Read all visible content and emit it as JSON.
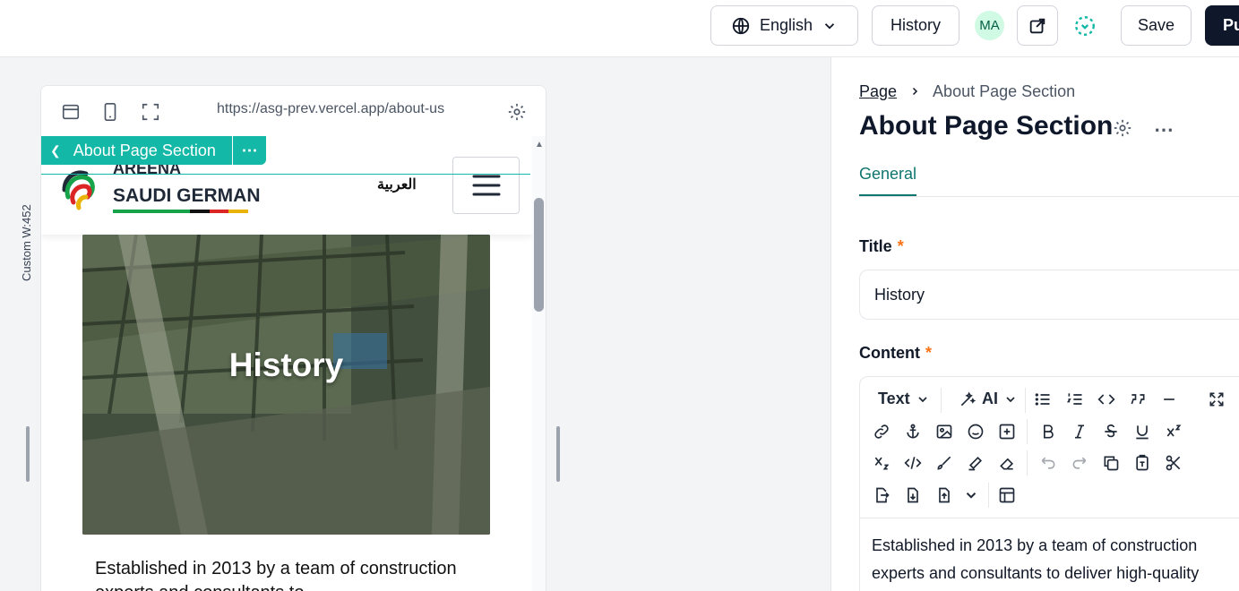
{
  "topbar": {
    "language": "English",
    "history_label": "History",
    "avatar_initials": "MA",
    "save_label": "Save",
    "publish_label": "Pu"
  },
  "canvas": {
    "size_label": "Custom W:452"
  },
  "preview": {
    "url": "https://asg-prev.vercel.app/about-us",
    "selected_component": "About Page Section",
    "site": {
      "logo_top": "AREENA",
      "logo_bottom": "SAUDI GERMAN",
      "language_link": "العربية",
      "hero_title": "History",
      "body_text": "Established in 2013 by a team of construction experts and consultants to"
    }
  },
  "panel": {
    "breadcrumb": [
      "Page",
      "About Page Section"
    ],
    "title": "About Page Section",
    "tabs": [
      "General"
    ],
    "fields": {
      "title_label": "Title",
      "title_value": "History",
      "content_label": "Content",
      "required_mark": "*"
    },
    "editor": {
      "text_style": "Text",
      "ai_label": "AI",
      "content": "Established in 2013 by a team of construction experts and consultants to deliver high-quality"
    }
  },
  "colors": {
    "accent": "#14b8a6",
    "primary_dark": "#0f172a",
    "tab_active": "#0f766e",
    "required": "#f97316"
  }
}
